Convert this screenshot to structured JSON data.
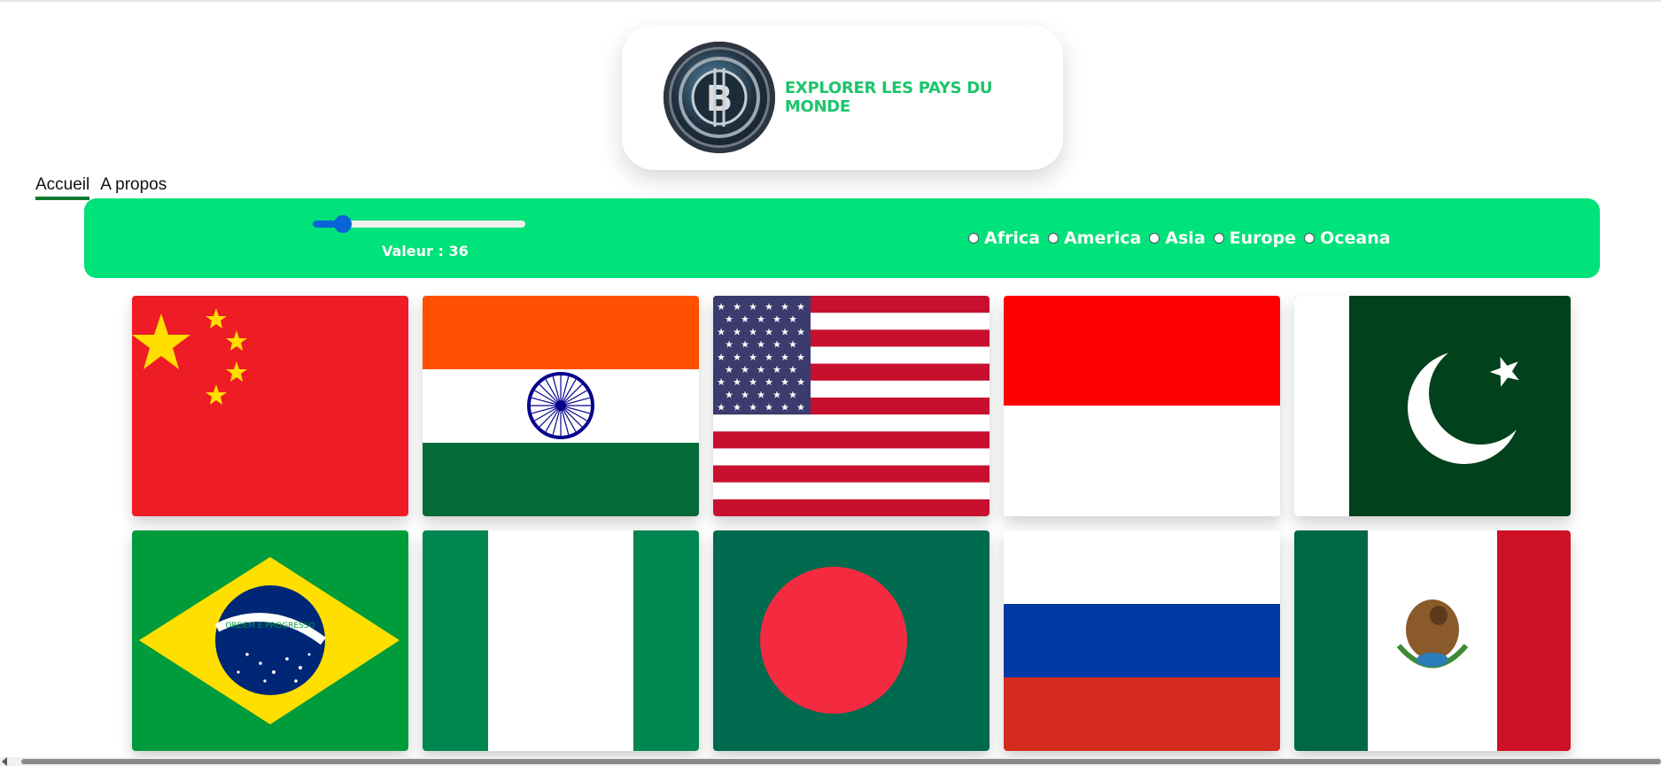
{
  "header": {
    "title": "EXPLORER LES PAYS DU MONDE",
    "logo_icon": "bitcoin-logo-icon"
  },
  "nav": {
    "items": [
      {
        "label": "Accueil",
        "active": true
      },
      {
        "label": "A propos",
        "active": false
      }
    ]
  },
  "filters": {
    "slider": {
      "value": 36,
      "min": 1,
      "max": 250,
      "value_text": "Valeur : 36"
    },
    "regions": [
      "Africa",
      "America",
      "Asia",
      "Europe",
      "Oceana"
    ]
  },
  "flags": [
    "China",
    "India",
    "United States",
    "Indonesia",
    "Pakistan",
    "Brazil",
    "Nigeria",
    "Bangladesh",
    "Russia",
    "Mexico"
  ],
  "brazil_motto": "ORDEM E PROGRESSO",
  "colors": {
    "accent_green": "#00e27a",
    "title_green": "#1cc46a",
    "slider_blue": "#0a64d8"
  }
}
